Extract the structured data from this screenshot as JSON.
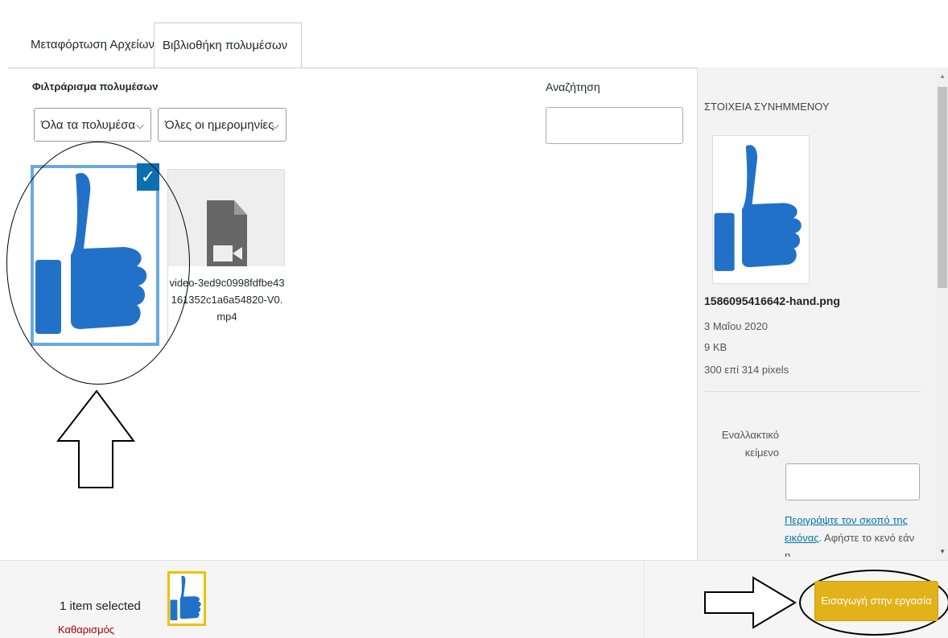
{
  "tabs": {
    "upload": "Μεταφόρτωση Αρχείων",
    "library": "Βιβλιοθήκη πολυμέσων"
  },
  "filters": {
    "title": "Φιλτράρισμα πολυμέσων",
    "media_type": "Όλα τα πολυμέσα",
    "dates": "Όλες οι ημερομηνίες"
  },
  "search": {
    "label": "Αναζήτηση",
    "value": ""
  },
  "library_items": [
    {
      "type": "image",
      "selected": true,
      "icon": "thumbs-up-icon"
    },
    {
      "type": "video",
      "selected": false,
      "filename": "video-3ed9c0998fdfbe43161352c1a6a54820-V0.mp4",
      "icon": "video-file-icon"
    }
  ],
  "attachment": {
    "section_title": "ΣΤΟΙΧΕΙΑ ΣΥΝΗΜΜΕΝΟΥ",
    "filename": "1586095416642-hand.png",
    "date": "3 Μαΐου 2020",
    "size": "9 KB",
    "dimensions": "300 επί 314 pixels",
    "alt_label": "Εναλλακτικό κείμενο",
    "alt_value": "",
    "help_link": "Περιγράψτε τον σκοπό της εικόνας",
    "help_rest": ". Αφήστε το κενό εάν η"
  },
  "footer": {
    "selection_count": "1 item selected",
    "clear_label": "Καθαρισμός",
    "insert_button": "Εισαγωγή στην εργασία"
  },
  "colors": {
    "accent": "#0b6fb0",
    "thumb": "#2271c9",
    "insert": "#e2b21b",
    "clear": "#aa0000"
  }
}
